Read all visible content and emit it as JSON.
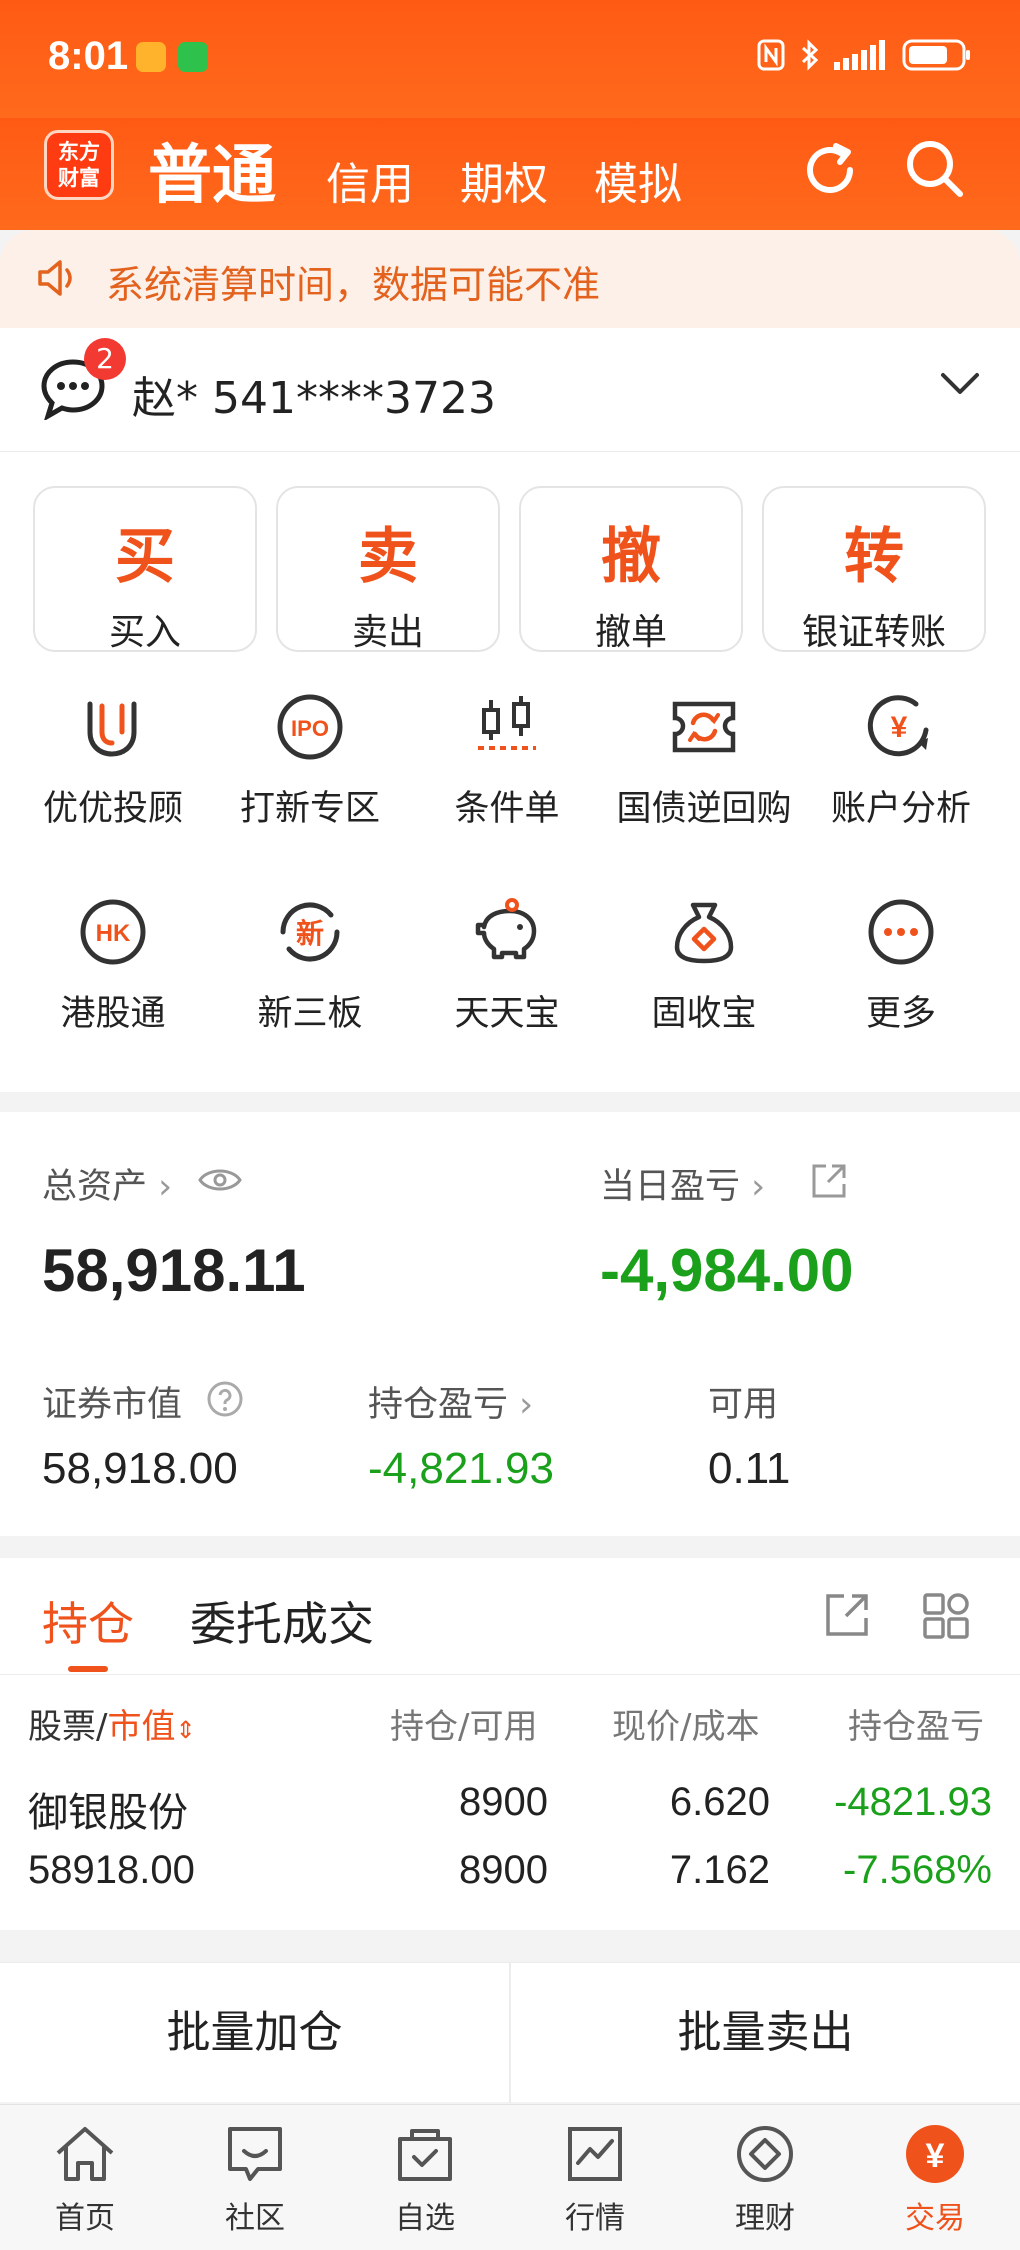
{
  "status_bar": {
    "time": "8:01"
  },
  "header": {
    "logo_top": "东方",
    "logo_bottom": "财富",
    "tabs": [
      "普通",
      "信用",
      "期权",
      "模拟"
    ]
  },
  "notice": {
    "text": "系统清算时间，数据可能不准"
  },
  "account": {
    "unread_badge": "2",
    "name_and_id": "赵* 541****3723"
  },
  "quick_actions": [
    {
      "glyph": "买",
      "label": "买入"
    },
    {
      "glyph": "卖",
      "label": "卖出"
    },
    {
      "glyph": "撤",
      "label": "撤单"
    },
    {
      "glyph": "转",
      "label": "银证转账"
    }
  ],
  "tools": [
    {
      "icon": "uu-advisor-icon",
      "label": "优优投顾"
    },
    {
      "icon": "ipo-icon",
      "label": "打新专区",
      "icon_text": "IPO"
    },
    {
      "icon": "conditional-order-icon",
      "label": "条件单"
    },
    {
      "icon": "repo-icon",
      "label": "国债逆回购"
    },
    {
      "icon": "account-analysis-icon",
      "label": "账户分析",
      "icon_text": "¥"
    },
    {
      "icon": "hk-icon",
      "label": "港股通",
      "icon_text": "HK"
    },
    {
      "icon": "neeq-icon",
      "label": "新三板",
      "icon_text": "新"
    },
    {
      "icon": "piggy-bank-icon",
      "label": "天天宝"
    },
    {
      "icon": "money-bag-icon",
      "label": "固收宝"
    },
    {
      "icon": "more-icon",
      "label": "更多"
    }
  ],
  "assets": {
    "total_label": "总资产",
    "total_value": "58,918.11",
    "daily_pl_label": "当日盈亏",
    "daily_pl_value": "-4,984.00",
    "market_value_label": "证券市值",
    "market_value": "58,918.00",
    "position_pl_label": "持仓盈亏",
    "position_pl_value": "-4,821.93",
    "available_label": "可用",
    "available_value": "0.11"
  },
  "holdings": {
    "tabs": [
      "持仓",
      "委托成交"
    ],
    "headers": {
      "stock": "股票/",
      "market_value": "市值",
      "qty": "持仓/可用",
      "price": "现价/成本",
      "pl": "持仓盈亏"
    },
    "rows": [
      {
        "name": "御银股份",
        "market_value": "58918.00",
        "position": "8900",
        "available": "8900",
        "price": "6.620",
        "cost": "7.162",
        "pl": "-4821.93",
        "pl_pct": "-7.568%"
      }
    ]
  },
  "batch": {
    "add": "批量加仓",
    "sell": "批量卖出"
  },
  "bottom_nav": [
    {
      "label": "首页",
      "icon": "home-icon"
    },
    {
      "label": "社区",
      "icon": "community-icon"
    },
    {
      "label": "自选",
      "icon": "watchlist-icon"
    },
    {
      "label": "行情",
      "icon": "market-icon"
    },
    {
      "label": "理财",
      "icon": "wealth-icon"
    },
    {
      "label": "交易",
      "icon": "trade-icon",
      "glyph": "¥",
      "active": true
    }
  ],
  "colors": {
    "accent": "#f0521c",
    "loss": "#1aa01a",
    "header": "#ff5a14"
  }
}
